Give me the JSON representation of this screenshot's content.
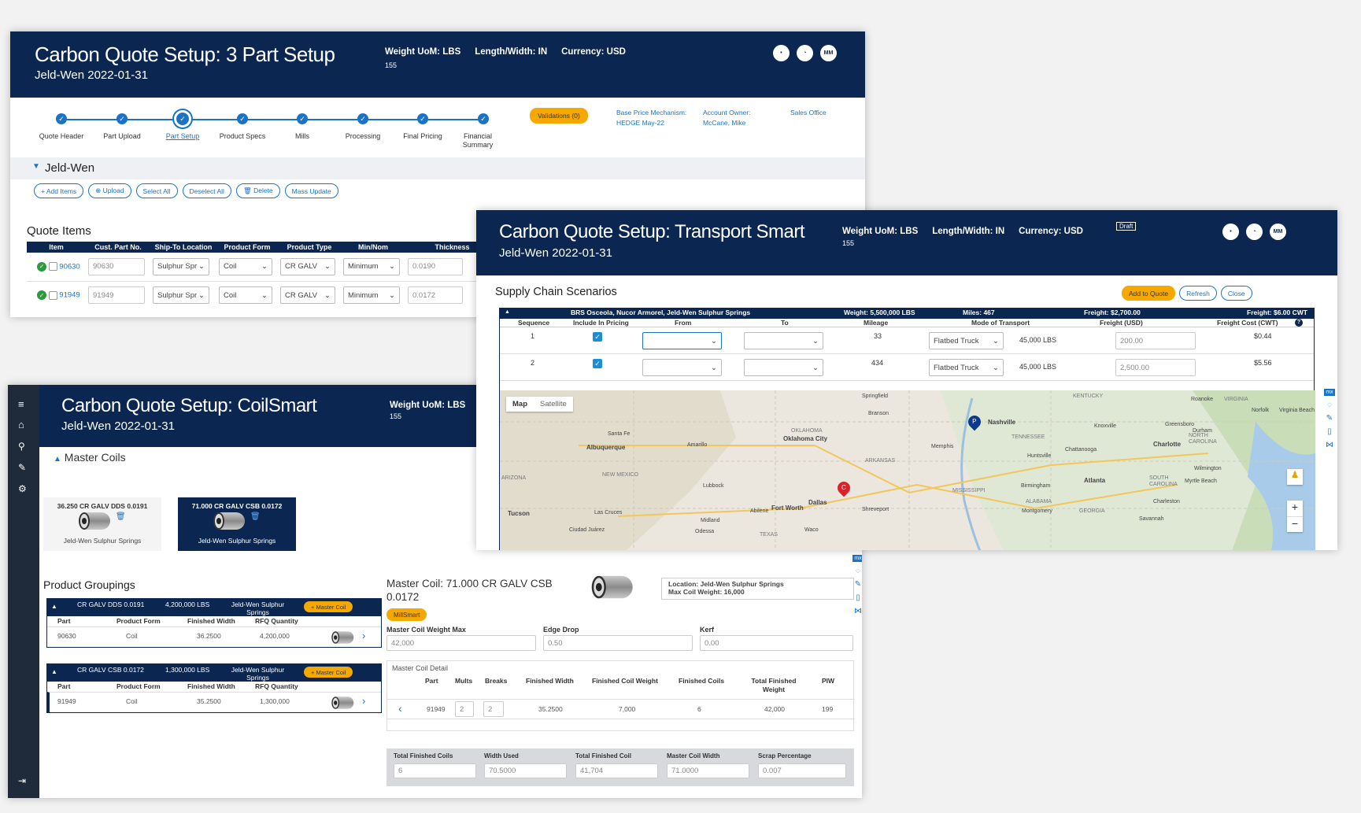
{
  "part_setup": {
    "title": "Carbon Quote Setup: 3 Part Setup",
    "subtitle": "Jeld-Wen 2022-01-31",
    "meta": {
      "weight": "Weight UoM: LBS",
      "length": "Length/Width: IN",
      "currency": "Currency: USD",
      "num": "155"
    },
    "header_icons": [
      "•",
      "◔",
      "MM"
    ],
    "steps": [
      "Quote Header",
      "Part Upload",
      "Part Setup",
      "Product Specs",
      "Mills",
      "Processing",
      "Final Pricing",
      "Financial Summary"
    ],
    "validations": "Validations (0)",
    "base_price_label": "Base Price Mechanism:",
    "base_price_value": "HEDGE May-22",
    "account_owner_label": "Account Owner:",
    "account_owner_value": "McCane, Mike",
    "sales_office_label": "Sales Office",
    "customer": "Jeld-Wen",
    "actions": [
      "+ Add Items",
      "⊕ Upload",
      "Select All",
      "Deselect All",
      "🗑 Delete",
      "Mass Update"
    ],
    "quote_items_title": "Quote Items",
    "columns": [
      "Item",
      "Cust. Part No.",
      "Ship-To Location",
      "Product Form",
      "Product Type",
      "Min/Nom",
      "Thickness"
    ],
    "rows": [
      {
        "item": "90630",
        "cust": "90630",
        "ship": "Sulphur Spr",
        "form": "Coil",
        "type": "CR GALV",
        "minnom": "Minimum",
        "thick": "0.0190"
      },
      {
        "item": "91949",
        "cust": "91949",
        "ship": "Sulphur Spr",
        "form": "Coil",
        "type": "CR GALV",
        "minnom": "Minimum",
        "thick": "0.0172"
      }
    ]
  },
  "transport": {
    "title": "Carbon Quote Setup: Transport Smart",
    "subtitle": "Jeld-Wen 2022-01-31",
    "meta": {
      "weight": "Weight UoM: LBS",
      "length": "Length/Width: IN",
      "currency": "Currency: USD",
      "num": "155"
    },
    "draft": "Draft",
    "header_icons": [
      "•",
      "◔",
      "MM"
    ],
    "section": "Supply Chain Scenarios",
    "buttons": {
      "add": "Add to Quote",
      "refresh": "Refresh",
      "close": "Close"
    },
    "summary": {
      "route": "BRS Osceola, Nucor Armorel, Jeld-Wen Sulphur Springs",
      "weight": "Weight: 5,500,000 LBS",
      "miles": "Miles: 467",
      "freight": "Freight: $2,700.00",
      "freight_cwt": "Freight: $6.00 CWT"
    },
    "columns": [
      "Sequence",
      "Include In Pricing",
      "From",
      "To",
      "Mileage",
      "Mode of Transport",
      "Freight (USD)",
      "Freight Cost (CWT)"
    ],
    "rows": [
      {
        "seq": "1",
        "miles": "33",
        "mode": "Flatbed Truck",
        "cap": "45,000 LBS",
        "freight": "200.00",
        "cwt": "$0.44"
      },
      {
        "seq": "2",
        "miles": "434",
        "mode": "Flatbed Truck",
        "cap": "45,000 LBS",
        "freight": "2,500.00",
        "cwt": "$5.56"
      }
    ],
    "map": {
      "tabs": [
        "Map",
        "Satellite"
      ],
      "places": [
        "Springfield",
        "KENTUCKY",
        "VIRGINIA",
        "Roanoke",
        "Nashville",
        "Knoxville",
        "Greensboro",
        "Durham",
        "Norfolk",
        "Virginia Beach",
        "Charlotte",
        "NORTH CAROLINA",
        "TENNESSEE",
        "Chattanooga",
        "Huntsville",
        "Albuquerque",
        "Santa Fe",
        "Amarillo",
        "OKLAHOMA",
        "Oklahoma City",
        "Memphis",
        "ARKANSAS",
        "NEW MEXICO",
        "Lubbock",
        "MISSISSIPPI",
        "Atlanta",
        "Birmingham",
        "SOUTH CAROLINA",
        "Myrtle Beach",
        "Wilmington",
        "ALABAMA",
        "Montgomery",
        "GEORGIA",
        "Charleston",
        "Savannah",
        "Tucson",
        "Las Cruces",
        "Ciudad Juárez",
        "Odessa",
        "Midland",
        "Abilene",
        "Fort Worth",
        "Dallas",
        "Shreveport",
        "Waco",
        "TEXAS",
        "ARIZONA",
        "Branson"
      ],
      "markers": [
        "P",
        "C"
      ],
      "zoom_in": "+",
      "zoom_out": "−"
    }
  },
  "coilsmart": {
    "title": "Carbon Quote Setup: CoilSmart",
    "subtitle": "Jeld-Wen 2022-01-31",
    "meta": {
      "weight": "Weight UoM: LBS",
      "num": "155"
    },
    "sidebar_icons": [
      "menu-icon",
      "home-icon",
      "search-icon",
      "wrench-icon",
      "gear-icon",
      "logout-icon"
    ],
    "master_coils_title": "Master Coils",
    "coil_cards": [
      {
        "name": "36.250 CR GALV DDS 0.0191",
        "loc": "Jeld-Wen Sulphur Springs"
      },
      {
        "name": "71.000 CR GALV CSB 0.0172",
        "loc": "Jeld-Wen Sulphur Springs"
      }
    ],
    "product_groupings_title": "Product Groupings",
    "groups": [
      {
        "name": "CR GALV DDS 0.0191",
        "lbs": "4,200,000 LBS",
        "loc": "Jeld-Wen Sulphur Springs",
        "btn": "+ Master Coil",
        "part": "90630",
        "form": "Coil",
        "width": "36.2500",
        "rfq": "4,200,000"
      },
      {
        "name": "CR GALV CSB 0.0172",
        "lbs": "1,300,000 LBS",
        "loc": "Jeld-Wen Sulphur Springs",
        "btn": "+ Master Coil",
        "part": "91949",
        "form": "Coil",
        "width": "35.2500",
        "rfq": "1,300,000"
      }
    ],
    "group_cols": [
      "Part",
      "Product Form",
      "Finished Width",
      "RFQ Quantity"
    ],
    "detail": {
      "title": "Master Coil: 71.000 CR GALV CSB 0.0172",
      "location": "Location: Jeld-Wen Sulphur Springs",
      "max_weight": "Max Coil Weight: 16,000",
      "millsmart": "MillSmart",
      "fields": [
        {
          "label": "Master Coil Weight Max",
          "value": "42,000"
        },
        {
          "label": "Edge Drop",
          "value": "0.50"
        },
        {
          "label": "Kerf",
          "value": "0.00"
        }
      ],
      "detail_title": "Master Coil Detail",
      "detail_cols": [
        "Part",
        "Mults",
        "Breaks",
        "Finished Width",
        "Finished Coil Weight",
        "Finished Coils",
        "Total Finished Weight",
        "PIW"
      ],
      "detail_row": {
        "part": "91949",
        "mults": "2",
        "breaks": "2",
        "width": "35.2500",
        "coil_weight": "7,000",
        "coils": "6",
        "total": "42,000",
        "piw": "199"
      },
      "totals": [
        {
          "label": "Total Finished Coils",
          "value": "6"
        },
        {
          "label": "Width Used",
          "value": "70.5000"
        },
        {
          "label": "Total Finished Coil",
          "value": "41,704"
        },
        {
          "label": "Master Coil Width",
          "value": "71.0000"
        },
        {
          "label": "Scrap Percentage",
          "value": "0.007"
        }
      ]
    },
    "right_tools": [
      "mx",
      "chat-icon",
      "edit-icon",
      "clipboard-icon",
      "share-icon"
    ]
  }
}
